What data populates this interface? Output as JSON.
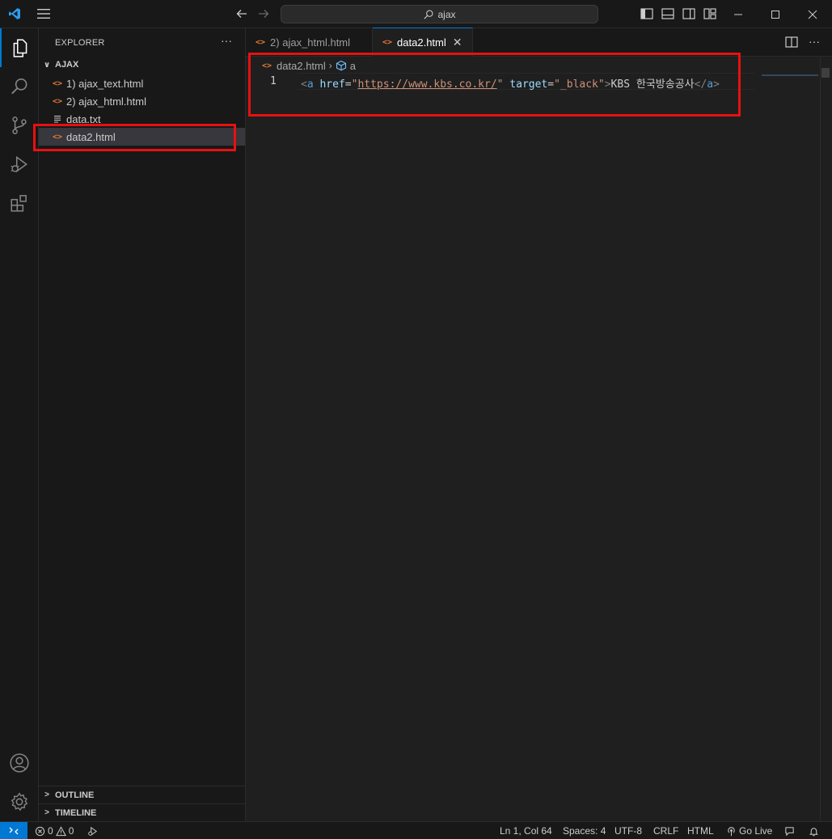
{
  "titlebar": {
    "search_text": "ajax",
    "icons": [
      "vscode-logo-icon",
      "menu-icon",
      "back-arrow-icon",
      "forward-arrow-icon",
      "search-icon",
      "toggle-sidebar-icon",
      "toggle-panel-icon",
      "toggle-secondary-sidebar-icon",
      "customize-layout-icon"
    ],
    "window_controls": [
      "minimize",
      "maximize",
      "close"
    ]
  },
  "activity_bar": {
    "items": [
      "explorer-icon",
      "search-icon",
      "source-control-icon",
      "run-debug-icon",
      "extensions-icon"
    ],
    "bottom": [
      "accounts-icon",
      "settings-gear-icon"
    ]
  },
  "sidebar": {
    "title": "EXPLORER",
    "more": "···",
    "folder": "AJAX",
    "files": [
      {
        "name": "1) ajax_text.html",
        "type": "html"
      },
      {
        "name": "2) ajax_html.html",
        "type": "html"
      },
      {
        "name": "data.txt",
        "type": "txt"
      },
      {
        "name": "data2.html",
        "type": "html",
        "selected": true
      }
    ],
    "outline": "OUTLINE",
    "timeline": "TIMELINE"
  },
  "tabs": [
    {
      "label": "2) ajax_html.html",
      "active": false
    },
    {
      "label": "data2.html",
      "active": true
    }
  ],
  "breadcrumb": {
    "file": "data2.html",
    "symbol": "a"
  },
  "editor": {
    "line_number": "1",
    "tokens": {
      "open_bracket": "<",
      "tag": "a",
      "attr1": "href",
      "eq": "=",
      "quote": "\"",
      "href_value": "https://www.kbs.co.kr/",
      "attr2": "target",
      "target_value": "_black",
      "close_bracket": ">",
      "text": "KBS 한국방송공사",
      "end_open": "</",
      "end_tag": "a",
      "end_close": ">"
    }
  },
  "statusbar": {
    "errors": "0",
    "warnings": "0",
    "position": "Ln 1, Col 64",
    "spaces": "Spaces: 4",
    "encoding": "UTF-8",
    "eol": "CRLF",
    "language": "HTML",
    "go_live": "Go Live"
  },
  "colors": {
    "accent": "#0078d4",
    "highlight_box": "#e81010",
    "html_icon": "#e37933"
  }
}
